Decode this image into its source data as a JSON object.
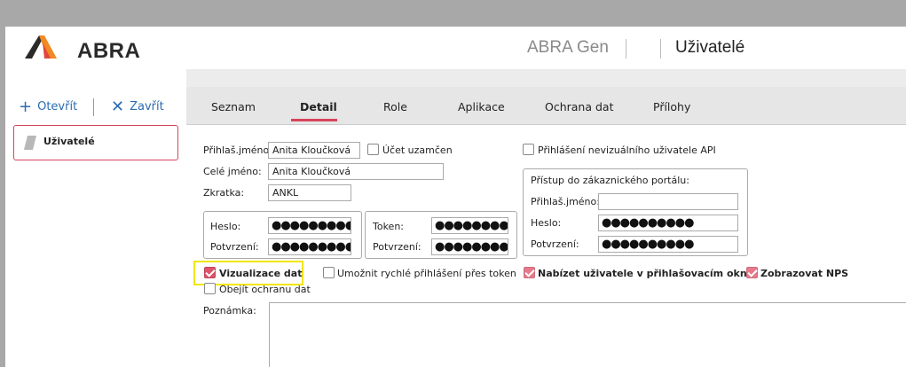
{
  "header": {
    "logo_text": "ABRA",
    "app_name": "ABRA Gen",
    "page_title": "Uživatelé"
  },
  "left_pane": {
    "open_label": "Otevřít",
    "close_label": "Zavřít",
    "card_label": "Uživatelé"
  },
  "tabs": [
    {
      "label": "Seznam",
      "active": false
    },
    {
      "label": "Detail",
      "active": true
    },
    {
      "label": "Role",
      "active": false
    },
    {
      "label": "Aplikace",
      "active": false
    },
    {
      "label": "Ochrana dat",
      "active": false
    },
    {
      "label": "Přílohy",
      "active": false
    }
  ],
  "form": {
    "login_label": "Přihlaš.jméno:",
    "login_value": "Anita Kloučková",
    "locked_label": "Účet uzamčen",
    "locked_checked": false,
    "fullname_label": "Celé jméno:",
    "fullname_value": "Anita Kloučková",
    "abbr_label": "Zkratka:",
    "abbr_value": "ANKL",
    "password_label": "Heslo:",
    "password_value": "●●●●●●●●●●",
    "confirm_label": "Potvrzení:",
    "confirm_value": "●●●●●●●●●●",
    "token_label": "Token:",
    "token_value": "●●●●●●●●●●",
    "token_confirm_label": "Potvrzení:",
    "token_confirm_value": "●●●●●●●●●●",
    "nonvisual_label": "Přihlášení nevizuálního uživatele API",
    "nonvisual_checked": false,
    "portal_title": "Přístup do zákaznického portálu:",
    "portal_login_label": "Přihlaš.jméno:",
    "portal_login_value": "",
    "portal_password_label": "Heslo:",
    "portal_password_value": "●●●●●●●●●●",
    "portal_confirm_label": "Potvrzení:",
    "portal_confirm_value": "●●●●●●●●●●",
    "vizualizace_label": "Vizualizace dat",
    "vizualizace_checked": true,
    "quick_login_label": "Umožnit rychlé přihlášení přes token",
    "quick_login_checked": false,
    "offer_user_label": "Nabízet uživatele v přihlašovacím okně",
    "offer_user_checked": true,
    "nps_label": "Zobrazovat NPS",
    "nps_checked": true,
    "bypass_label": "Obejít ochranu dat",
    "bypass_checked": false,
    "note_label": "Poznámka:",
    "note_value": ""
  },
  "colors": {
    "accent": "#d6455a",
    "link": "#2b6cb0",
    "highlight": "#f2e600"
  }
}
